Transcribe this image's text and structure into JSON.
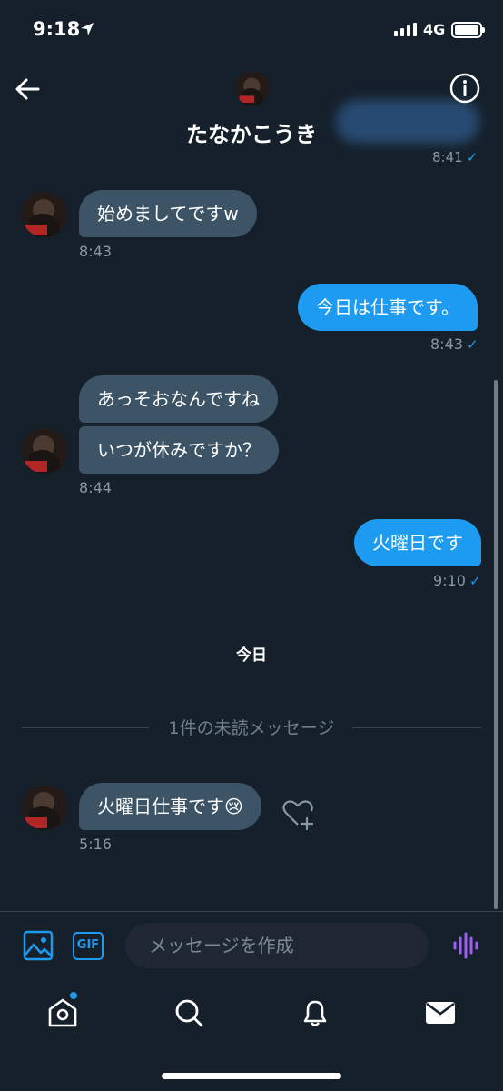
{
  "status_bar": {
    "time": "9:18",
    "network": "4G"
  },
  "header": {
    "title": "たなかこうき"
  },
  "partial_time": "8:41",
  "messages": [
    {
      "side": "in",
      "text": "始めましてですw",
      "time": "8:43"
    },
    {
      "side": "out",
      "text": "今日は仕事です。",
      "time": "8:43"
    },
    {
      "side": "in",
      "text": "あっそおなんですね",
      "time": ""
    },
    {
      "side": "in",
      "text": "いつが休みですか？",
      "time": "8:44"
    },
    {
      "side": "out",
      "text": "火曜日です",
      "time": "9:10"
    },
    {
      "side": "in",
      "text": "火曜日仕事です😢",
      "time": "5:16"
    }
  ],
  "day_label": "今日",
  "unread_divider": "1件の未読メッセージ",
  "composer": {
    "gif_label": "GIF",
    "placeholder": "メッセージを作成"
  },
  "check_mark": "✓",
  "colors": {
    "background": "#15202b",
    "accent": "#1d9bf0",
    "incoming_bubble": "#3d5466",
    "voice": "#a05cf6"
  }
}
